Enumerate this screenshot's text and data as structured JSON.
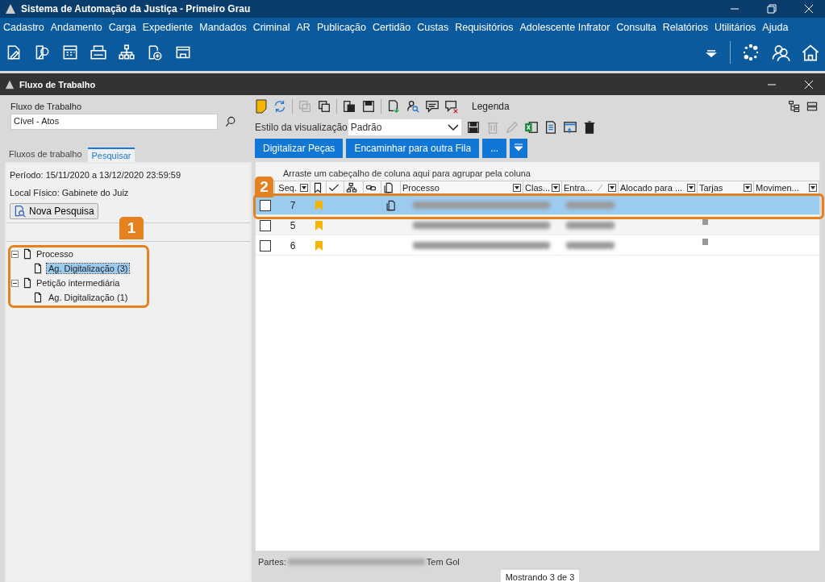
{
  "window": {
    "title": "Sistema de Automação da Justiça - Primeiro Grau"
  },
  "menu": [
    "Cadastro",
    "Andamento",
    "Carga",
    "Expediente",
    "Mandados",
    "Criminal",
    "AR",
    "Publicação",
    "Certidão",
    "Custas",
    "Requisitórios",
    "Adolescente Infrator",
    "Consulta",
    "Relatórios",
    "Utilitários",
    "Ajuda"
  ],
  "subwindow": {
    "title": "Fluxo de Trabalho"
  },
  "left": {
    "workflow_label": "Fluxo de Trabalho",
    "workflow_value": "Cível - Atos",
    "tabs": [
      {
        "label": "Fluxos de trabalho",
        "selected": false
      },
      {
        "label": "Pesquisar",
        "selected": true
      }
    ],
    "period": "Período: 15/11/2020 a 13/12/2020 23:59:59",
    "local": "Local Físico: Gabinete do Juiz",
    "new_search": "Nova Pesquisa",
    "tree": [
      {
        "label": "Processo",
        "expanded": true,
        "children": [
          {
            "label": "Ag. Digitalização (3)",
            "selected": true
          }
        ]
      },
      {
        "label": "Petição intermediária",
        "expanded": true,
        "children": [
          {
            "label": "Ag. Digitalização (1)",
            "selected": false
          }
        ]
      }
    ]
  },
  "callouts": [
    "1",
    "2"
  ],
  "toolbar": {
    "legend": "Legenda",
    "view_style_label": "Estilo da visualização",
    "view_style": "Padrão",
    "buttons": [
      "Digitalizar Peças",
      "Encaminhar para outra Fila",
      "..."
    ]
  },
  "grid": {
    "group_hint": "Arraste um cabeçalho de coluna aqui para agrupar pela coluna",
    "columns": [
      "Seq.",
      "Processo",
      "Clas...",
      "Entra...",
      "Alocado para ...",
      "Tarjas",
      "Movimen..."
    ],
    "rows": [
      {
        "seq": "7",
        "checked": false,
        "selected": true,
        "tarja": false,
        "attachment": true
      },
      {
        "seq": "5",
        "checked": false,
        "selected": false,
        "tarja": true,
        "attachment": false
      },
      {
        "seq": "6",
        "checked": false,
        "selected": false,
        "tarja": true,
        "attachment": false
      }
    ]
  },
  "parts": {
    "label": "Partes:",
    "suffix": "Tem Gol"
  },
  "status": "Mostrando 3 de 3"
}
